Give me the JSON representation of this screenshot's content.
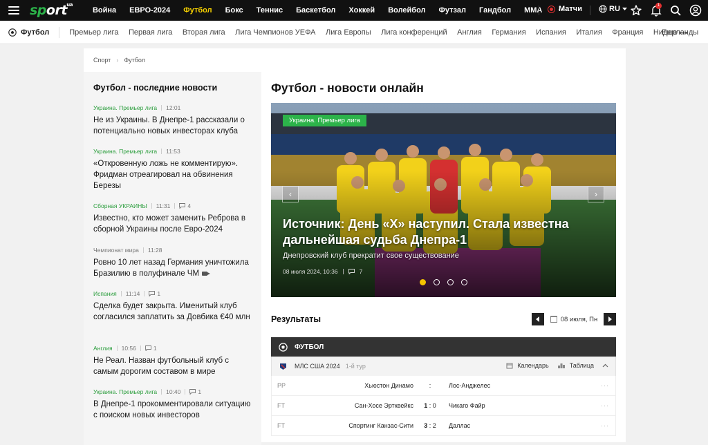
{
  "topnav": {
    "logo_main": "sport",
    "logo_sup": "ua",
    "items": [
      "Война",
      "ЕВРО-2024",
      "Футбол",
      "Бокс",
      "Теннис",
      "Баскетбол",
      "Хоккей",
      "Волейбол",
      "Футзал",
      "Гандбол",
      "ММА"
    ],
    "active_index": 2,
    "more": "···",
    "matches_label": "Матчи",
    "lang_label": "RU",
    "notif_count": "1"
  },
  "subnav": {
    "sport_label": "Футбол",
    "items": [
      "Премьер лига",
      "Первая лига",
      "Вторая лига",
      "Лига Чемпионов УЕФА",
      "Лига Европы",
      "Лига конференций",
      "Англия",
      "Германия",
      "Испания",
      "Италия",
      "Франция",
      "Нидерланды"
    ],
    "more_label": "Еще"
  },
  "breadcrumb": [
    "Спорт",
    "Футбол"
  ],
  "sidebar": {
    "title": "Футбол - последние новости",
    "news": [
      {
        "category": "Украина. Премьер лига",
        "time": "12:01",
        "comments": "",
        "title": "Не из Украины. В Днепре-1 рассказали о потенциально новых инвесторах клуба",
        "video": false
      },
      {
        "category": "Украина. Премьер лига",
        "time": "11:53",
        "comments": "",
        "title": "«Откровенную ложь не комментирую». Фридман отреагировал на обвинения Березы",
        "video": false
      },
      {
        "category": "Сборная УКРАИНЫ",
        "time": "11:31",
        "comments": "4",
        "title": "Известно, кто может заменить Реброва в сборной Украины после Евро-2024",
        "video": false
      },
      {
        "category": "Чемпионат мира",
        "time": "11:28",
        "comments": "",
        "title": "Ровно 10 лет назад Германия уничтожила Бразилию в полуфинале ЧМ",
        "video": true
      },
      {
        "category": "Испания",
        "time": "11:14",
        "comments": "1",
        "title": "Сделка будет закрыта. Именитый клуб согласился заплатить за Довбика €40 млн",
        "video": false
      },
      {
        "category": "Англия",
        "time": "10:56",
        "comments": "1",
        "title": "Не Реал. Назван футбольный клуб с самым дорогим составом в мире",
        "video": false
      },
      {
        "category": "Украина. Премьер лига",
        "time": "10:40",
        "comments": "1",
        "title": "В Днепре-1 прокомментировали ситуацию с поиском новых инвесторов",
        "video": false
      }
    ]
  },
  "main": {
    "title": "Футбол - новости онлайн",
    "hero": {
      "tag": "Украина. Премьер лига",
      "title": "Источник: День «Х» наступил. Стала известна дальнейшая судьба Днепра-1",
      "subtitle": "Днепровский клуб прекратит свое существование",
      "date": "08 июля 2024, 10:36",
      "comments": "7",
      "slides": 4,
      "active_slide": 0
    },
    "results": {
      "title": "Результаты",
      "date": "08 июля, Пн",
      "sport": "ФУТБОЛ",
      "league": "МЛС США 2024",
      "round": "1-й тур",
      "calendar_label": "Календарь",
      "table_label": "Таблица",
      "matches": [
        {
          "status": "PP",
          "home": "Хьюстон Динамо",
          "home_score": "",
          "sep": ":",
          "away_score": "",
          "away": "Лос-Анджелес"
        },
        {
          "status": "FT",
          "home": "Сан-Хосе Эртквейкс",
          "home_score": "1",
          "sep": ":",
          "away_score": "0",
          "away": "Чикаго Файр"
        },
        {
          "status": "FT",
          "home": "Спортинг Канзас-Сити",
          "home_score": "3",
          "sep": ":",
          "away_score": "2",
          "away": "Даллас"
        }
      ]
    }
  },
  "colors": {
    "accent_green": "#2cb34a",
    "active_yellow": "#f5d000",
    "topbar": "#111111",
    "live_red": "#e03030"
  }
}
